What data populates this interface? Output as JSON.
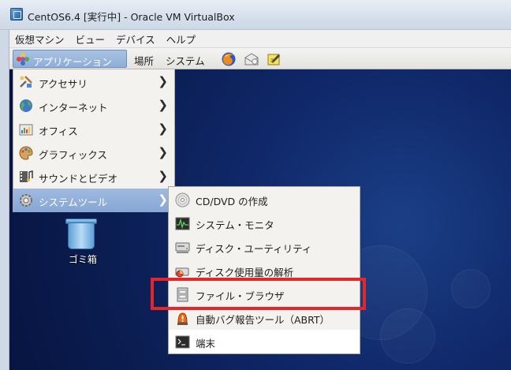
{
  "window": {
    "title": "CentOS6.4 [実行中] - Oracle VM VirtualBox"
  },
  "vbox_menubar": [
    {
      "id": "machine",
      "label": "仮想マシン"
    },
    {
      "id": "view",
      "label": "ビュー"
    },
    {
      "id": "devices",
      "label": "デバイス"
    },
    {
      "id": "help",
      "label": "ヘルプ"
    }
  ],
  "gnome_panel": {
    "applications": "アプリケーション",
    "places": "場所",
    "system": "システム",
    "launchers": [
      "firefox-icon",
      "mail-icon",
      "notes-icon"
    ]
  },
  "applications_menu": [
    {
      "id": "accessories",
      "label": "アクセサリ",
      "icon": "accessories-icon"
    },
    {
      "id": "internet",
      "label": "インターネット",
      "icon": "internet-globe-icon"
    },
    {
      "id": "office",
      "label": "オフィス",
      "icon": "office-icon"
    },
    {
      "id": "graphics",
      "label": "グラフィックス",
      "icon": "graphics-palette-icon"
    },
    {
      "id": "sound-video",
      "label": "サウンドとビデオ",
      "icon": "film-music-icon"
    },
    {
      "id": "system-tools",
      "label": "システムツール",
      "icon": "system-gear-icon",
      "active": true
    }
  ],
  "system_tools_menu": [
    {
      "id": "cd-dvd-create",
      "label": "CD/DVD の作成",
      "icon": "cd-icon"
    },
    {
      "id": "system-monitor",
      "label": "システム・モニタ",
      "icon": "system-monitor-icon"
    },
    {
      "id": "disk-utility",
      "label": "ディスク・ユーティリティ",
      "icon": "disk-utility-icon"
    },
    {
      "id": "disk-usage",
      "label": "ディスク使用量の解析",
      "icon": "disk-usage-icon"
    },
    {
      "id": "file-browser",
      "label": "ファイル・ブラウザ",
      "icon": "file-browser-icon"
    },
    {
      "id": "abrt",
      "label": "自動バグ報告ツール（ABRT）",
      "icon": "bug-alert-icon"
    },
    {
      "id": "terminal",
      "label": "端末",
      "icon": "terminal-icon",
      "highlighted": true
    }
  ],
  "desktop": {
    "trash_label": "ゴミ箱"
  },
  "colors": {
    "highlight_red": "#e3262a",
    "menu_active": "#8eaed8",
    "desktop_blue": "#10296b"
  }
}
